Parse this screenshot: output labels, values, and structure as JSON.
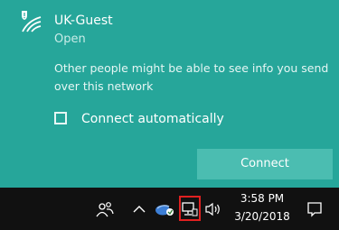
{
  "network": {
    "name": "UK-Guest",
    "status": "Open",
    "warning": "Other people might be able to see info you send over this network",
    "checkbox_label": "Connect automatically",
    "checkbox_checked": false,
    "connect_label": "Connect"
  },
  "taskbar": {
    "time": "3:58 PM",
    "date": "3/20/2018",
    "icons": [
      "people-icon",
      "chevron-up-icon",
      "defender-icon",
      "network-icon",
      "volume-icon",
      "action-center-icon"
    ]
  },
  "colors": {
    "panel": "#26a69a",
    "button": "#4bbdb1",
    "taskbar": "#111111",
    "highlight": "#e02020"
  }
}
